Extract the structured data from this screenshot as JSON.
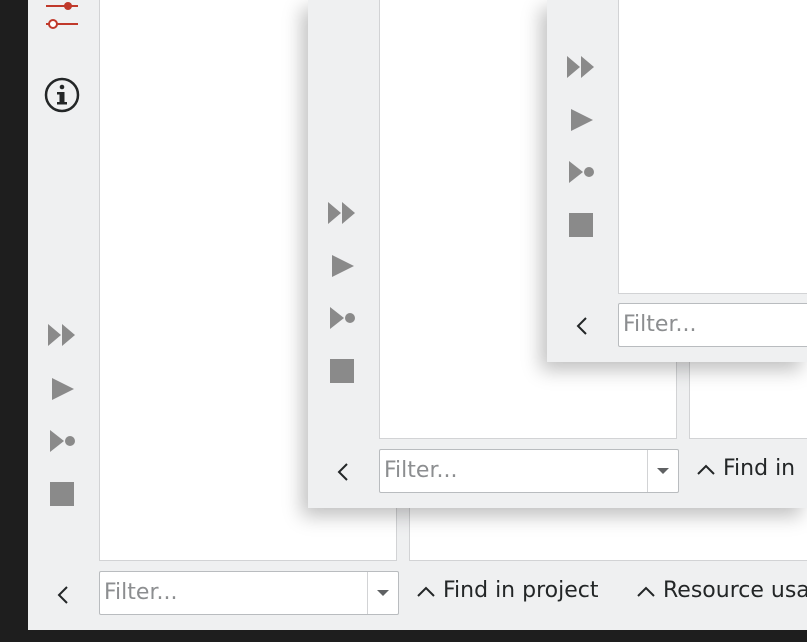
{
  "filter_placeholder": "Filter...",
  "bottom_tools": {
    "find_in_project": "Find in project",
    "resource_usage": "Resource usa"
  },
  "middle_tools": {
    "find_in_project": "Find in"
  },
  "icons": {
    "controls": [
      "fast-forward-icon",
      "play-icon",
      "step-icon",
      "stop-icon"
    ],
    "sidebar": [
      "settings-sliders-icon",
      "info-icon"
    ]
  },
  "colors": {
    "window_bg": "#eff0f1",
    "accent_red": "#c0392b",
    "icon_gray": "#8a8a8a"
  }
}
